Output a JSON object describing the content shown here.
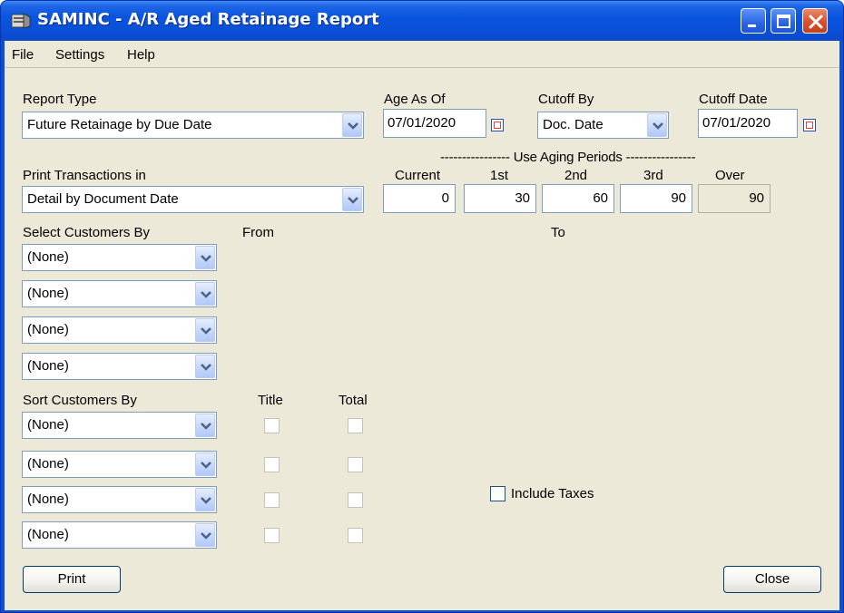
{
  "window": {
    "title": "SAMINC - A/R Aged Retainage Report",
    "icon": "report-app-icon"
  },
  "menu": [
    "File",
    "Settings",
    "Help"
  ],
  "report_type": {
    "label": "Report Type",
    "value": "Future Retainage by Due Date"
  },
  "age_as_of": {
    "label": "Age As Of",
    "value": "07/01/2020"
  },
  "cutoff_by": {
    "label": "Cutoff By",
    "value": "Doc. Date"
  },
  "cutoff_date": {
    "label": "Cutoff Date",
    "value": "07/01/2020"
  },
  "print_transactions": {
    "label": "Print Transactions in",
    "value": "Detail by Document Date"
  },
  "aging": {
    "header": "---------------- Use Aging Periods ----------------",
    "columns": [
      "Current",
      "1st",
      "2nd",
      "3rd",
      "Over"
    ],
    "values": [
      "0",
      "30",
      "60",
      "90",
      "90"
    ]
  },
  "select_customers": {
    "label": "Select Customers By",
    "from_label": "From",
    "to_label": "To",
    "rows": [
      "(None)",
      "(None)",
      "(None)",
      "(None)"
    ]
  },
  "sort_customers": {
    "label": "Sort Customers By",
    "title_label": "Title",
    "total_label": "Total",
    "rows": [
      "(None)",
      "(None)",
      "(None)",
      "(None)"
    ]
  },
  "include_taxes": {
    "label": "Include Taxes",
    "checked": false
  },
  "buttons": {
    "print": "Print",
    "close": "Close"
  },
  "colors": {
    "titlebar": "#0a4fd8",
    "client_bg": "#ece9d8",
    "field_border": "#7f9db9",
    "button_border": "#003c74",
    "close_button": "#d6502f"
  }
}
